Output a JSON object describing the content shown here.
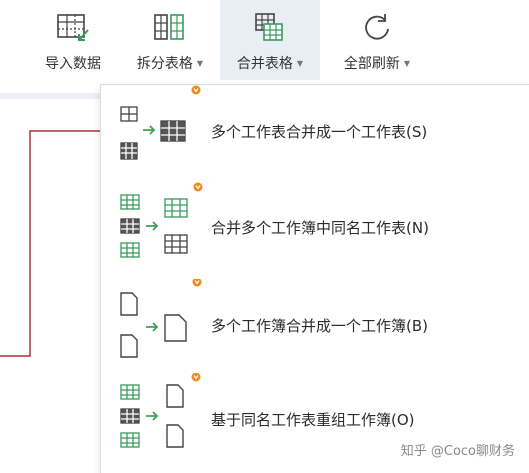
{
  "toolbar": {
    "import_label": "导入数据",
    "split_label": "拆分表格",
    "merge_label": "合并表格",
    "refresh_label": "全部刷新",
    "caret": "▼"
  },
  "menu": {
    "items": [
      {
        "label": "多个工作表合并成一个工作表(S)"
      },
      {
        "label": "合并多个工作簿中同名工作表(N)"
      },
      {
        "label": "多个工作簿合并成一个工作簿(B)"
      },
      {
        "label": "基于同名工作表重组工作簿(O)"
      }
    ]
  },
  "colors": {
    "accent_green": "#3a9a5a",
    "arrow_green": "#3ca35a",
    "vip_badge": "#f08a1c",
    "connector_red": "#a33"
  },
  "watermark": "知乎 @Coco聊财务"
}
